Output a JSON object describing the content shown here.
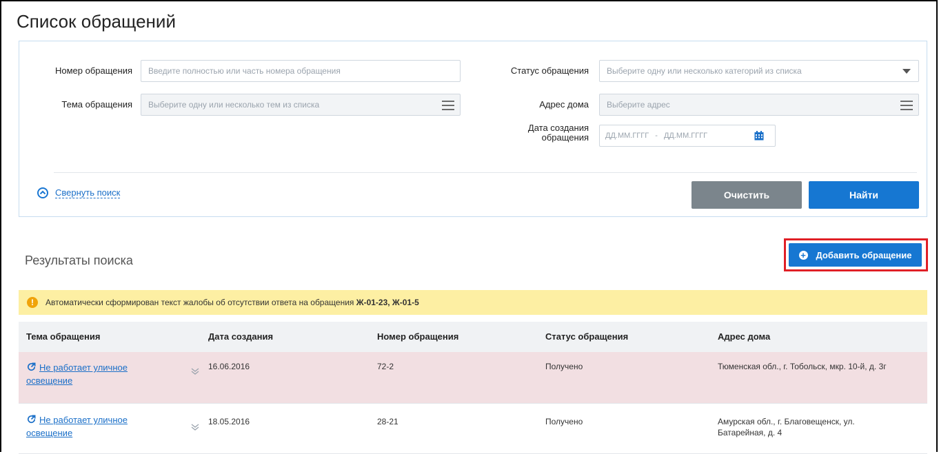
{
  "page": {
    "title": "Список обращений"
  },
  "search": {
    "number_label": "Номер обращения",
    "number_placeholder": "Введите полностью или часть номера обращения",
    "topic_label": "Тема обращения",
    "topic_placeholder": "Выберите одну или несколько тем из списка",
    "status_label": "Статус обращения",
    "status_placeholder": "Выберите одну или несколько категорий из списка",
    "address_label": "Адрес дома",
    "address_placeholder": "Выберите адрес",
    "date_label_line1": "Дата создания",
    "date_label_line2": "обращения",
    "date_from_placeholder": "ДД.ММ.ГГГГ",
    "date_sep": "-",
    "date_to_placeholder": "ДД.ММ.ГГГГ",
    "collapse_label": "Свернуть поиск",
    "clear_label": "Очистить",
    "find_label": "Найти"
  },
  "results": {
    "title": "Результаты поиска",
    "add_label": "Добавить обращение",
    "notice_text": "Автоматически сформирован текст жалобы об отсутствии ответа на обращения ",
    "notice_bold": "Ж-01-23, Ж-01-5"
  },
  "table": {
    "headers": [
      "Тема обращения",
      "Дата создания",
      "Номер обращения",
      "Статус обращения",
      "Адрес дома"
    ],
    "rows": [
      {
        "topic_line1": "Не работает уличное",
        "topic_line2": "освещение",
        "date": "16.06.2016",
        "number": "72-2",
        "status": "Получено",
        "address_line1": "Тюменская обл., г. Тобольск, мкр. 10-й, д. 3г",
        "address_line2": ""
      },
      {
        "topic_line1": "Не работает уличное",
        "topic_line2": "освещение",
        "date": "18.05.2016",
        "number": "28-21",
        "status": "Получено",
        "address_line1": "Амурская обл., г. Благовещенск, ул.",
        "address_line2": "Батарейная, д. 4"
      }
    ]
  },
  "colors": {
    "accent": "#1677d2",
    "clear_button": "#7b858c",
    "highlight_border": "#e01f26",
    "notice_bg": "#fdefa3",
    "row_highlight": "#f2dfe2"
  },
  "icons": [
    "chevron-down-icon",
    "menu-icon",
    "calendar-icon",
    "chevron-up-icon",
    "plus-circle-icon",
    "warning-icon",
    "link-icon",
    "double-chevron-down-icon"
  ]
}
